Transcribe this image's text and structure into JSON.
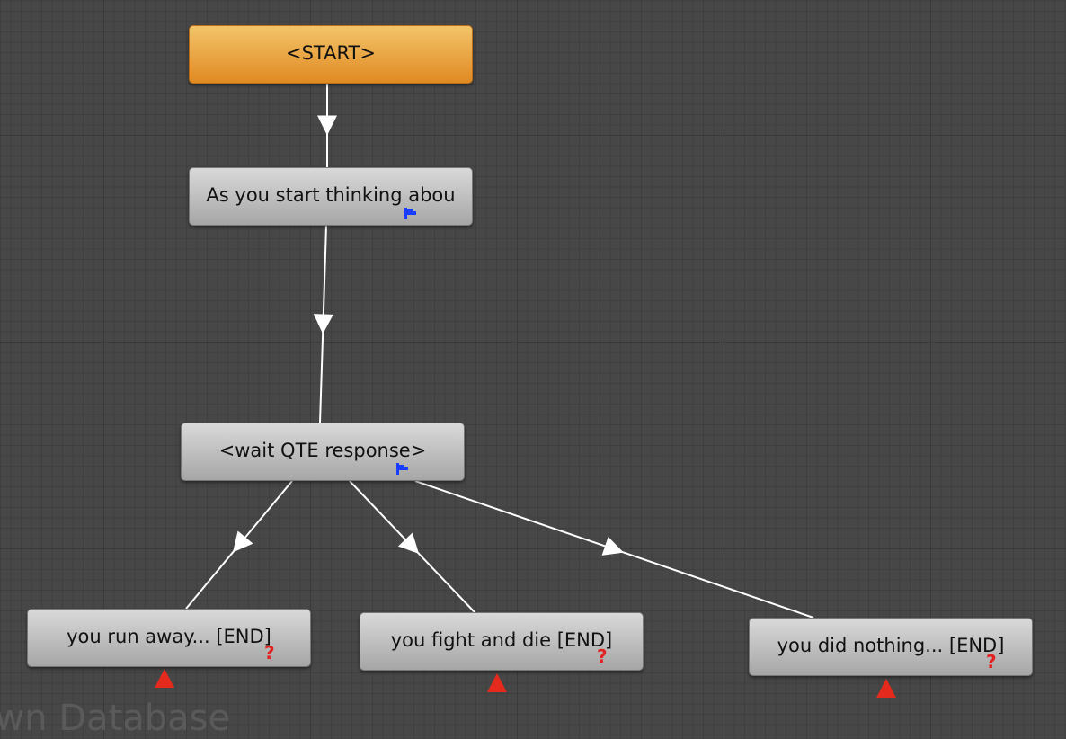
{
  "nodes": {
    "start": "<START>",
    "intro": "As you start thinking abou",
    "wait": "<wait QTE response>",
    "run": "you run away... [END]",
    "fight": "you fight and die [END]",
    "nothing": "you did nothing... [END]"
  },
  "watermark": "own Database",
  "colors": {
    "background": "#474747",
    "node": "#c3c3c3",
    "start_node": "#e8922a",
    "link": "#ffffff",
    "flag_icon": "#1a3cff",
    "question_icon": "#e32222",
    "end_marker": "#e32a1c"
  },
  "links": [
    {
      "from": "start",
      "to": "intro"
    },
    {
      "from": "intro",
      "to": "wait"
    },
    {
      "from": "wait",
      "to": "run"
    },
    {
      "from": "wait",
      "to": "fight"
    },
    {
      "from": "wait",
      "to": "nothing"
    }
  ]
}
